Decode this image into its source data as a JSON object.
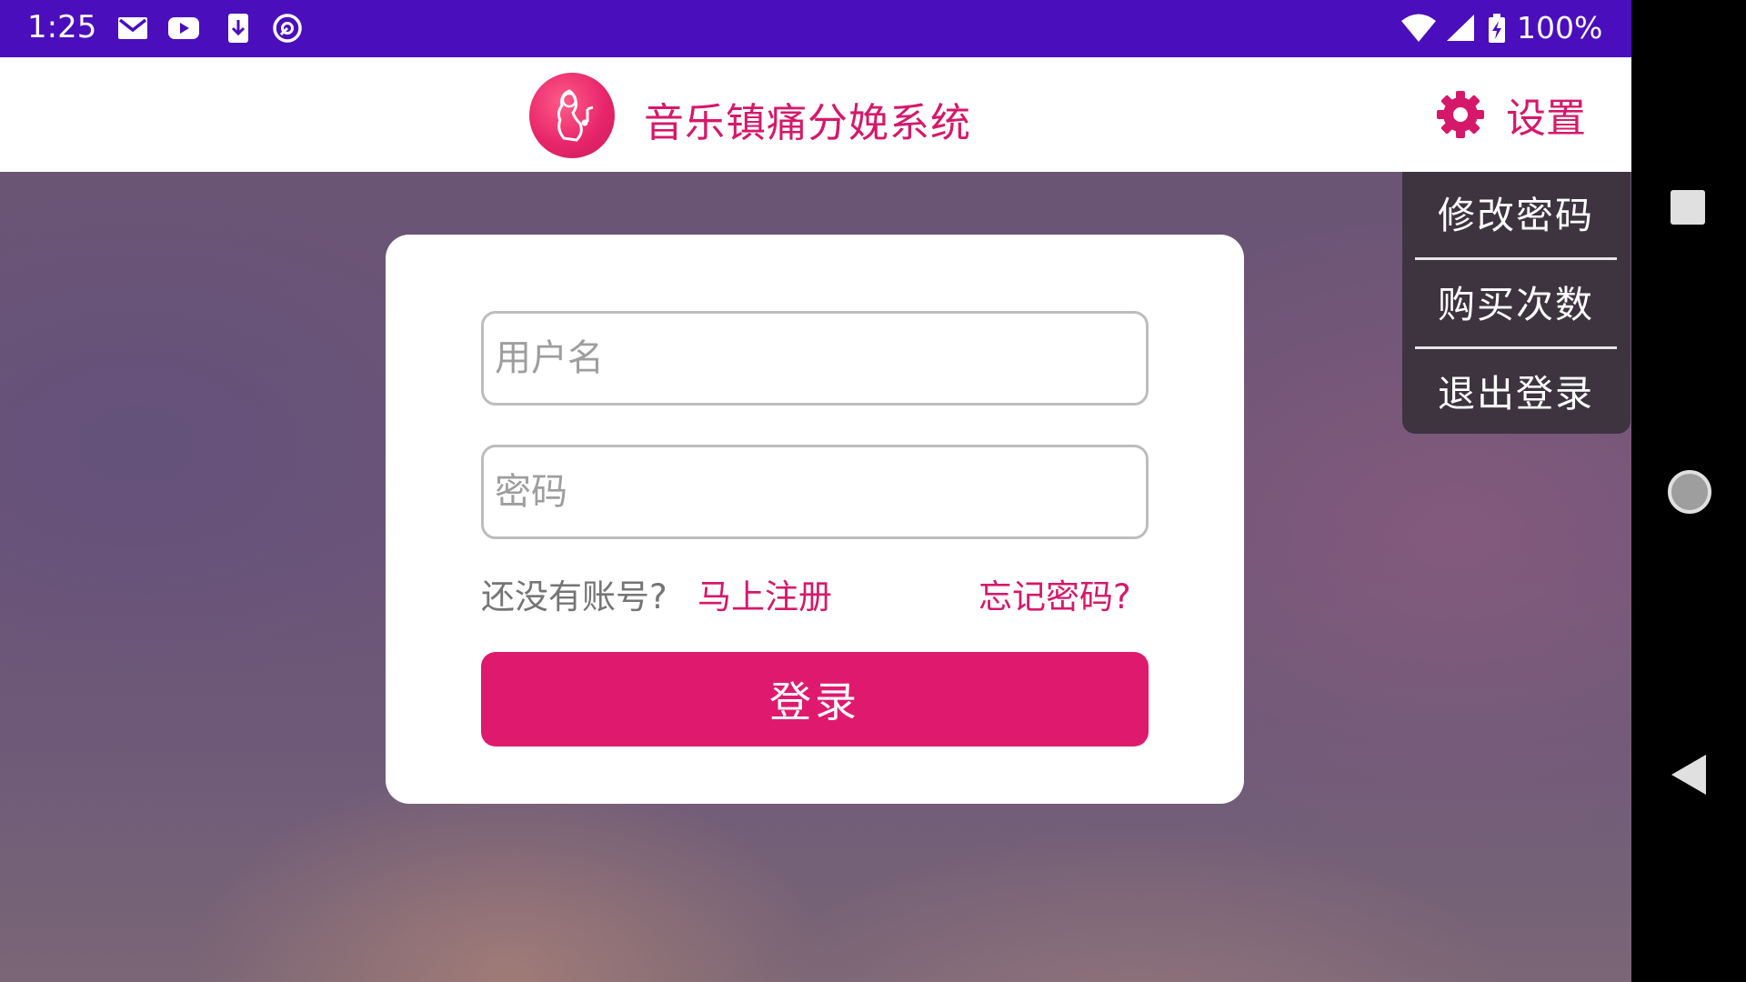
{
  "status_bar": {
    "time": "1:25",
    "battery_percent": "100%",
    "icons": [
      "gmail-icon",
      "youtube-icon",
      "download-icon",
      "assistant-icon",
      "wifi-icon",
      "cellular-signal-icon",
      "battery-charging-icon"
    ]
  },
  "header": {
    "app_title": "音乐镇痛分娩系统",
    "logo_icon": "pregnant-woman-music-logo",
    "settings_label": "设置",
    "settings_icon": "gear-icon"
  },
  "login_form": {
    "username_placeholder": "用户名",
    "username_value": "",
    "password_placeholder": "密码",
    "password_value": "",
    "no_account_text": "还没有账号?",
    "register_link": "马上注册",
    "forgot_password_link": "忘记密码?",
    "login_button": "登录"
  },
  "settings_menu": {
    "items": [
      {
        "label": "修改密码"
      },
      {
        "label": "购买次数"
      },
      {
        "label": "退出登录"
      }
    ]
  },
  "nav_bar": {
    "icons": [
      "recents-square-icon",
      "home-circle-icon",
      "back-triangle-icon"
    ]
  },
  "colors": {
    "status_bar": "#4a0ebd",
    "accent": "#d6186a",
    "login_button": "#df1a6e",
    "menu_background": "#3d3440"
  }
}
